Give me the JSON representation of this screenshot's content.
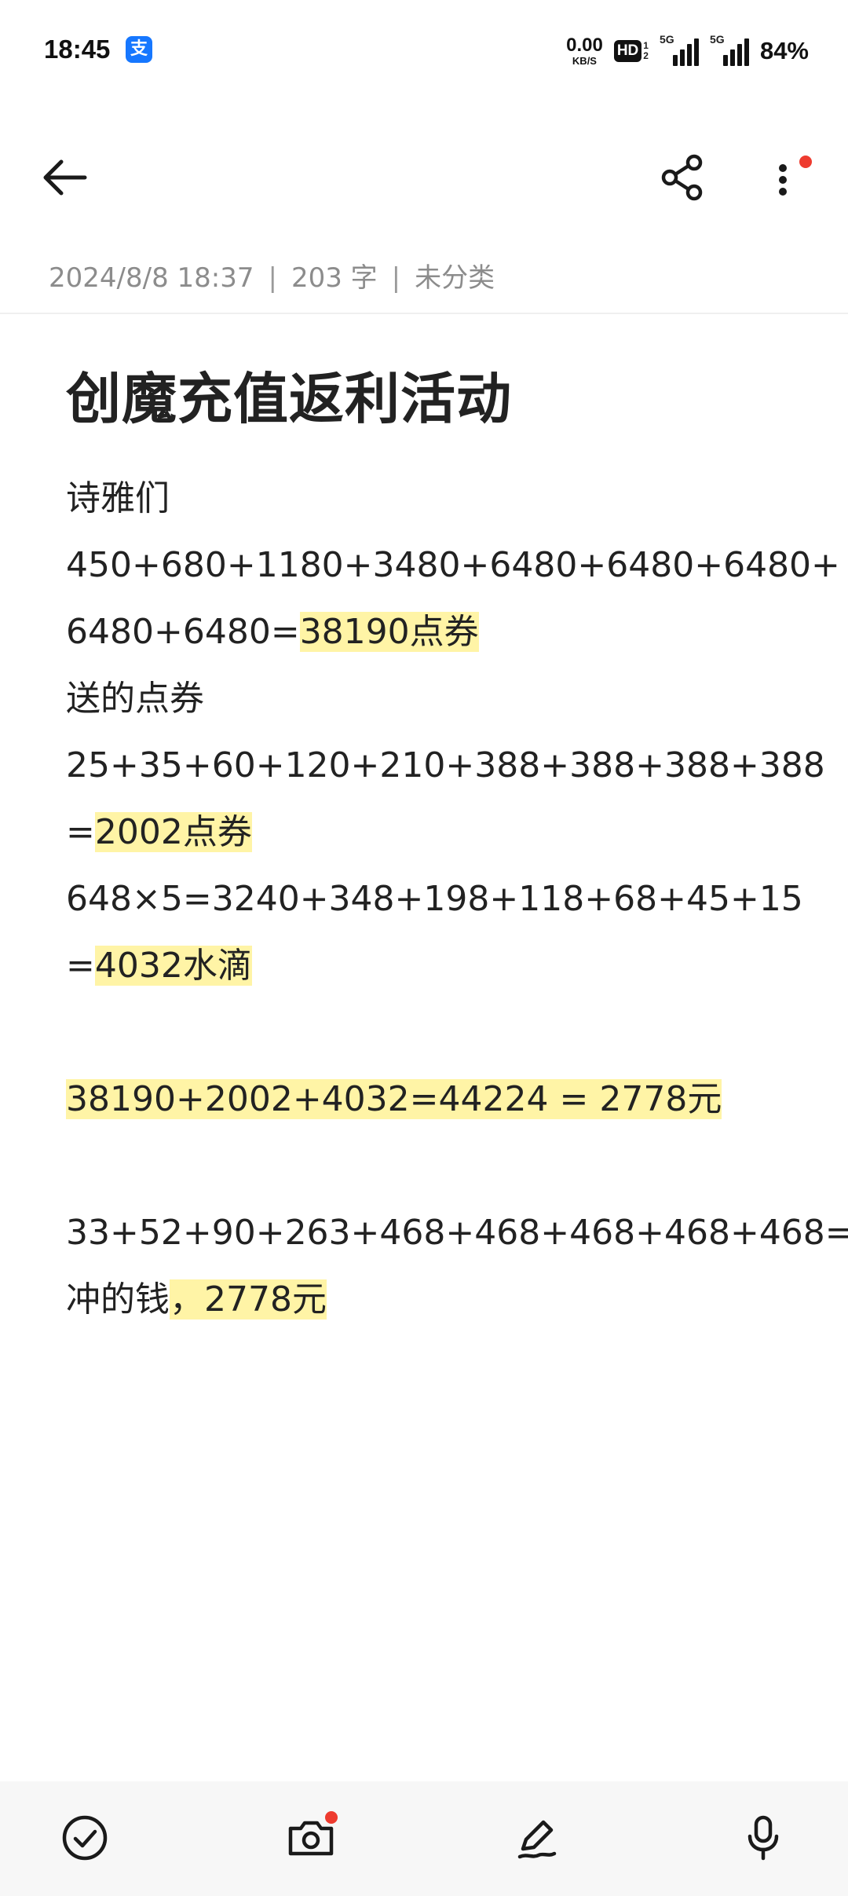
{
  "status_bar": {
    "time": "18:45",
    "app_icon_glyph": "支",
    "net_speed_value": "0.00",
    "net_speed_unit": "KB/S",
    "hd_label": "HD",
    "hd_sim_top": "1",
    "hd_sim_bottom": "2",
    "signal1_label": "5G",
    "signal2_label": "5G",
    "battery": "84%"
  },
  "toolbar": {
    "back_icon": "arrow-left-icon",
    "share_icon": "share-icon",
    "more_icon": "more-vertical-icon",
    "notification_dot_color": "#ee3b2f"
  },
  "meta": {
    "date": "2024/8/8 18:37",
    "separator": "|",
    "word_count": "203 字",
    "category": "未分类"
  },
  "note": {
    "title": "创魔充值返利活动",
    "highlight_color": "#fff4a6",
    "lines": [
      {
        "plain": "诗雅们",
        "highlight": ""
      },
      {
        "plain": "450+680+1180+3480+6480+6480+6480+",
        "highlight": ""
      },
      {
        "plain": "6480+6480=",
        "highlight": "38190点券"
      },
      {
        "plain": "送的点券",
        "highlight": ""
      },
      {
        "plain": "25+35+60+120+210+388+388+388+388",
        "highlight": ""
      },
      {
        "plain": "=",
        "highlight": "2002点券"
      },
      {
        "plain": "648×5=3240+348+198+118+68+45+15",
        "highlight": ""
      },
      {
        "plain": "=",
        "highlight": "4032水滴"
      },
      {
        "plain": "",
        "highlight": ""
      },
      {
        "plain": "",
        "highlight": "38190+2002+4032=44224 = 2778元"
      },
      {
        "plain": "",
        "highlight": ""
      },
      {
        "plain": "33+52+90+263+468+468+468+468+468=",
        "highlight": ""
      },
      {
        "plain": "冲的钱",
        "highlight": "，2778元"
      }
    ]
  },
  "bottom_bar": {
    "checklist_icon": "check-circle-icon",
    "camera_icon": "camera-icon",
    "handwriting_icon": "pen-icon",
    "voice_icon": "microphone-icon"
  }
}
